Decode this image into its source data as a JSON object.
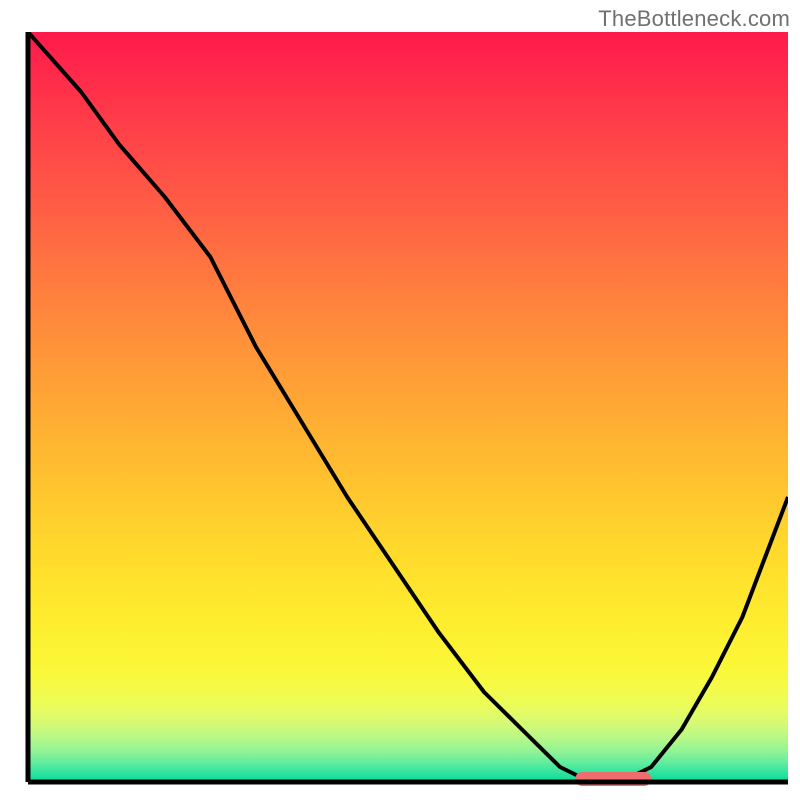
{
  "watermark": "TheBottleneck.com",
  "chart_data": {
    "type": "line",
    "title": "",
    "xlabel": "",
    "ylabel": "",
    "xlim": [
      0,
      100
    ],
    "ylim": [
      0,
      100
    ],
    "x": [
      0,
      7,
      12,
      18,
      24,
      30,
      36,
      42,
      48,
      54,
      60,
      66,
      70,
      74,
      78,
      82,
      86,
      90,
      94,
      97,
      100
    ],
    "values": [
      100,
      92,
      85,
      78,
      70,
      58,
      48,
      38,
      29,
      20,
      12,
      6,
      2,
      0,
      0,
      2,
      7,
      14,
      22,
      30,
      38
    ],
    "marker": {
      "x_start": 72,
      "x_end": 82,
      "y": 0
    },
    "gradient_stops": [
      {
        "offset": 0.0,
        "color": "#ff1a4b"
      },
      {
        "offset": 0.06,
        "color": "#ff2b4b"
      },
      {
        "offset": 0.12,
        "color": "#ff3d49"
      },
      {
        "offset": 0.18,
        "color": "#ff4e47"
      },
      {
        "offset": 0.24,
        "color": "#ff5f44"
      },
      {
        "offset": 0.3,
        "color": "#ff7141"
      },
      {
        "offset": 0.36,
        "color": "#ff823d"
      },
      {
        "offset": 0.42,
        "color": "#ff9339"
      },
      {
        "offset": 0.48,
        "color": "#ffa335"
      },
      {
        "offset": 0.54,
        "color": "#ffb332"
      },
      {
        "offset": 0.6,
        "color": "#ffc22f"
      },
      {
        "offset": 0.66,
        "color": "#ffd22d"
      },
      {
        "offset": 0.72,
        "color": "#ffe02c"
      },
      {
        "offset": 0.78,
        "color": "#feec2e"
      },
      {
        "offset": 0.84,
        "color": "#fbf636"
      },
      {
        "offset": 0.87,
        "color": "#f6fa44"
      },
      {
        "offset": 0.9,
        "color": "#eafc5c"
      },
      {
        "offset": 0.92,
        "color": "#d7fa72"
      },
      {
        "offset": 0.94,
        "color": "#baf886"
      },
      {
        "offset": 0.96,
        "color": "#8ff396"
      },
      {
        "offset": 0.975,
        "color": "#5eec9e"
      },
      {
        "offset": 0.988,
        "color": "#2ee39e"
      },
      {
        "offset": 1.0,
        "color": "#07db97"
      }
    ],
    "axis_color": "#000000",
    "line_color": "#000000",
    "marker_color": "#ef6d6d"
  }
}
